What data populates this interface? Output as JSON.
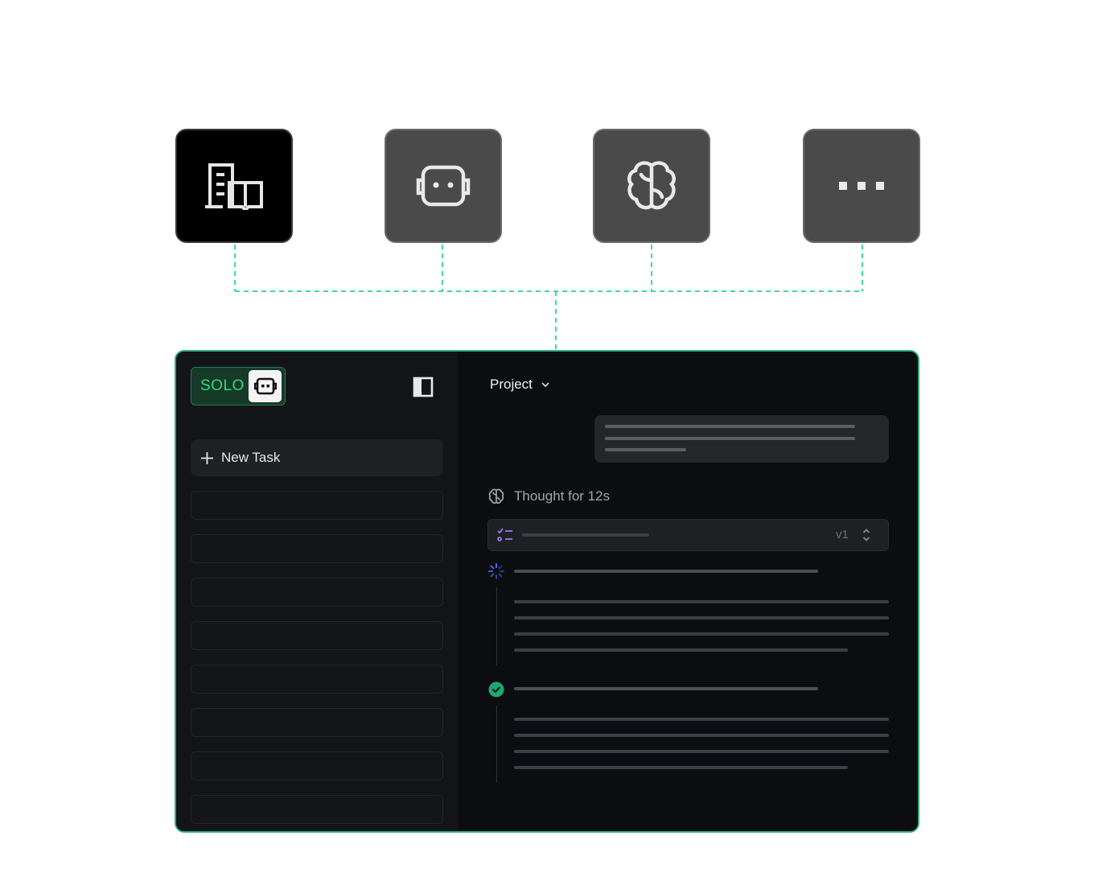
{
  "tiles": [
    {
      "icon": "building-icon",
      "style": "dark"
    },
    {
      "icon": "robot-icon",
      "style": "grey"
    },
    {
      "icon": "brain-icon",
      "style": "grey"
    },
    {
      "icon": "more-dots-icon",
      "style": "grey"
    }
  ],
  "colors": {
    "accent_green": "#36d77d",
    "connector": "#3ddc97",
    "window_border": "#2fae7a",
    "spinner_blue": "#4b6bff",
    "check_green": "#1fa673",
    "list_purple": "#9a7cf0"
  },
  "sidebar": {
    "logo_text": "SOLO",
    "new_task_label": "New Task",
    "task_slots": 8
  },
  "main": {
    "project_label": "Project",
    "thought_label": "Thought for 12s",
    "plan": {
      "version": "v1"
    },
    "steps": [
      {
        "status": "in-progress"
      },
      {
        "status": "done"
      }
    ]
  }
}
